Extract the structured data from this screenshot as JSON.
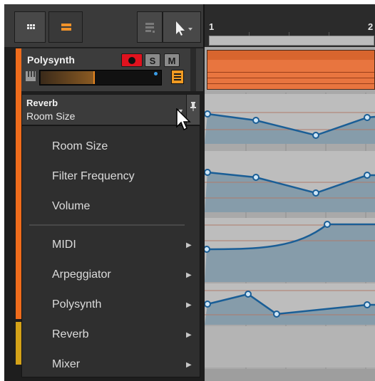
{
  "ruler": {
    "bar_1": "1",
    "bar_2": "2"
  },
  "toolbar": {
    "grid_icon": "grid-icon",
    "list_icon": "list-icon",
    "mute_icon": "mute-lines-icon",
    "pointer_icon": "pointer-icon"
  },
  "track": {
    "name": "Polysynth",
    "color": "#ef6c1c",
    "solo_label": "S",
    "mute_label": "M",
    "record_color": "#e0121e"
  },
  "parameter": {
    "device": "Reverb",
    "name": "Room Size"
  },
  "menu": {
    "params": [
      {
        "label": "Room Size"
      },
      {
        "label": "Filter Frequency"
      },
      {
        "label": "Volume"
      }
    ],
    "submenus": [
      {
        "label": "MIDI",
        "arrow": "▶"
      },
      {
        "label": "Arpeggiator",
        "arrow": "▶"
      },
      {
        "label": "Polysynth",
        "arrow": "▶"
      },
      {
        "label": "Reverb",
        "arrow": "▶"
      },
      {
        "label": "Mixer",
        "arrow": "▶"
      }
    ]
  },
  "colors": {
    "accent_orange": "#ef6c1c",
    "automation_line": "#1a5e96",
    "automation_fill": "#7d97a7",
    "clip_color": "#e8753f"
  }
}
